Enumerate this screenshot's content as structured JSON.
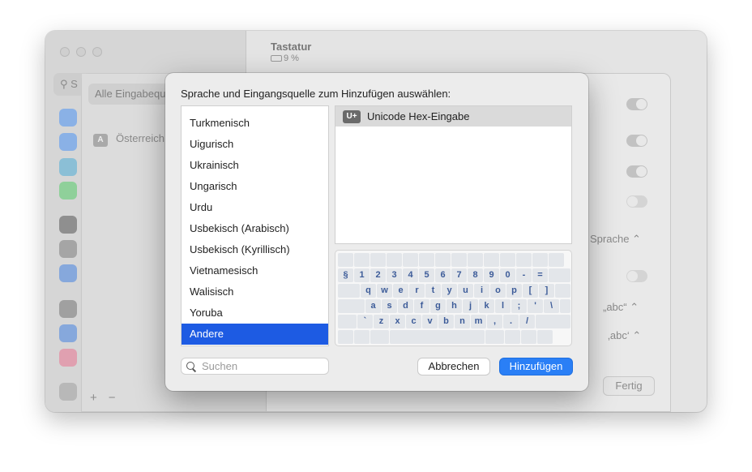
{
  "window": {
    "title": "Tastatur",
    "subtitle": "9 %",
    "search_placeholder": "S"
  },
  "input_sources_sheet": {
    "header": "Alle Eingabequ",
    "item_key": "A",
    "item_label": "Österreich",
    "add": "+",
    "remove": "−",
    "language_label": "Sprache",
    "quote_label_1": "„abc“",
    "quote_label_2": "‚abc‘",
    "done_button": "Fertig"
  },
  "dialog": {
    "title": "Sprache und Eingangsquelle zum Hinzufügen auswählen:",
    "languages": [
      "Turkmenisch",
      "Uigurisch",
      "Ukrainisch",
      "Ungarisch",
      "Urdu",
      "Usbekisch (Arabisch)",
      "Usbekisch (Kyrillisch)",
      "Vietnamesisch",
      "Walisisch",
      "Yoruba",
      "Andere"
    ],
    "selected_language": "Andere",
    "sources": [
      {
        "icon": "U+",
        "label": "Unicode Hex-Eingabe"
      }
    ],
    "keyboard": {
      "row1": [
        "§",
        "1",
        "2",
        "3",
        "4",
        "5",
        "6",
        "7",
        "8",
        "9",
        "0",
        "-",
        "="
      ],
      "row2": [
        "q",
        "w",
        "e",
        "r",
        "t",
        "y",
        "u",
        "i",
        "o",
        "p",
        "[",
        "]"
      ],
      "row3": [
        "a",
        "s",
        "d",
        "f",
        "g",
        "h",
        "j",
        "k",
        "l",
        ";",
        "'",
        "\\"
      ],
      "row4": [
        "`",
        "z",
        "x",
        "c",
        "v",
        "b",
        "n",
        "m",
        ",",
        ".",
        "/"
      ]
    },
    "search_placeholder": "Suchen",
    "cancel_label": "Abbrechen",
    "add_label": "Hinzufügen"
  },
  "colors": {
    "selection": "#1d5be3",
    "primary_button": "#2a7ff6"
  }
}
